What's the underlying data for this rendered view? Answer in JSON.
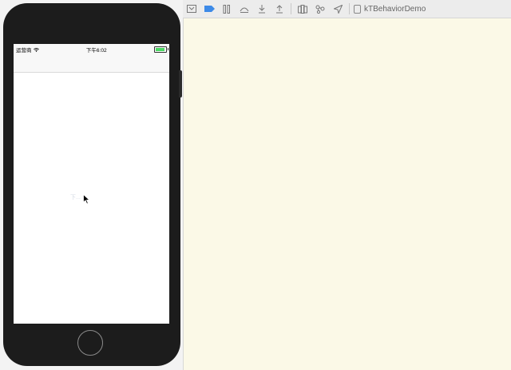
{
  "toolbar": {
    "icons": [
      "view-debugger-icon",
      "breakpoint-icon",
      "pause-icon",
      "step-over-icon",
      "step-into-icon",
      "step-out-icon",
      "debug-view-hierarchy-icon",
      "memory-graph-icon",
      "location-icon"
    ],
    "scheme_name": "kTBehaviorDemo"
  },
  "simulator": {
    "status_bar": {
      "carrier": "运营商",
      "time": "下午6:02",
      "battery_level": 0.9
    },
    "content": {
      "faint_label": "下..."
    }
  },
  "colors": {
    "canvas_background": "#fbf9e7",
    "battery_fill": "#4cd964",
    "breakpoint_accent": "#3d8ae7"
  }
}
